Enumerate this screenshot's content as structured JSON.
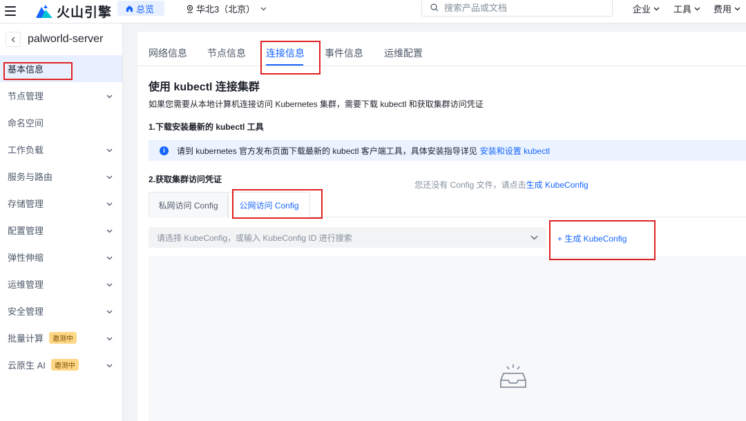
{
  "topbar": {
    "brand": "火山引擎",
    "overview_label": "总览",
    "region_label": "华北3（北京）",
    "search_placeholder": "搜索产品或文档",
    "menus": [
      "企业",
      "工具",
      "费用"
    ]
  },
  "sidebar": {
    "cluster_name": "palworld-server",
    "items": [
      {
        "label": "基本信息",
        "active": true,
        "chevron": false
      },
      {
        "label": "节点管理",
        "chevron": true
      },
      {
        "label": "命名空间",
        "chevron": false
      },
      {
        "label": "工作负载",
        "chevron": true
      },
      {
        "label": "服务与路由",
        "chevron": true
      },
      {
        "label": "存储管理",
        "chevron": true
      },
      {
        "label": "配置管理",
        "chevron": true
      },
      {
        "label": "弹性伸缩",
        "chevron": true
      },
      {
        "label": "运维管理",
        "chevron": true
      },
      {
        "label": "安全管理",
        "chevron": true
      },
      {
        "label": "批量计算",
        "badge": "邀测中",
        "chevron": true
      },
      {
        "label": "云原生 AI",
        "badge": "邀测中",
        "chevron": true
      }
    ]
  },
  "main": {
    "tabs": [
      "网络信息",
      "节点信息",
      "连接信息",
      "事件信息",
      "运维配置"
    ],
    "active_tab": "连接信息",
    "title": "使用 kubectl 连接集群",
    "description": "如果您需要从本地计算机连接访问 Kubernetes 集群，需要下载 kubectl 和获取集群访问凭证",
    "step1": "1.下载安装最新的 kubectl 工具",
    "info_text": "请到 kubernetes 官方发布页面下载最新的 kubectl 客户端工具，具体安装指导详见",
    "info_link": "安装和设置 kubectl",
    "step2": "2.获取集群访问凭证",
    "config_tabs": [
      "私网访问 Config",
      "公网访问 Config"
    ],
    "select_placeholder": "请选择 KubeConfig，或输入 KubeConfig ID 进行搜索",
    "generate_link": "+ 生成 KubeConfig",
    "empty_text": "您还没有 Config 文件，请点击",
    "empty_link": "生成 KubeConfig"
  },
  "colors": {
    "primary": "#1664ff",
    "annotation_red": "#e02020",
    "badge_bg": "#ffd887"
  }
}
